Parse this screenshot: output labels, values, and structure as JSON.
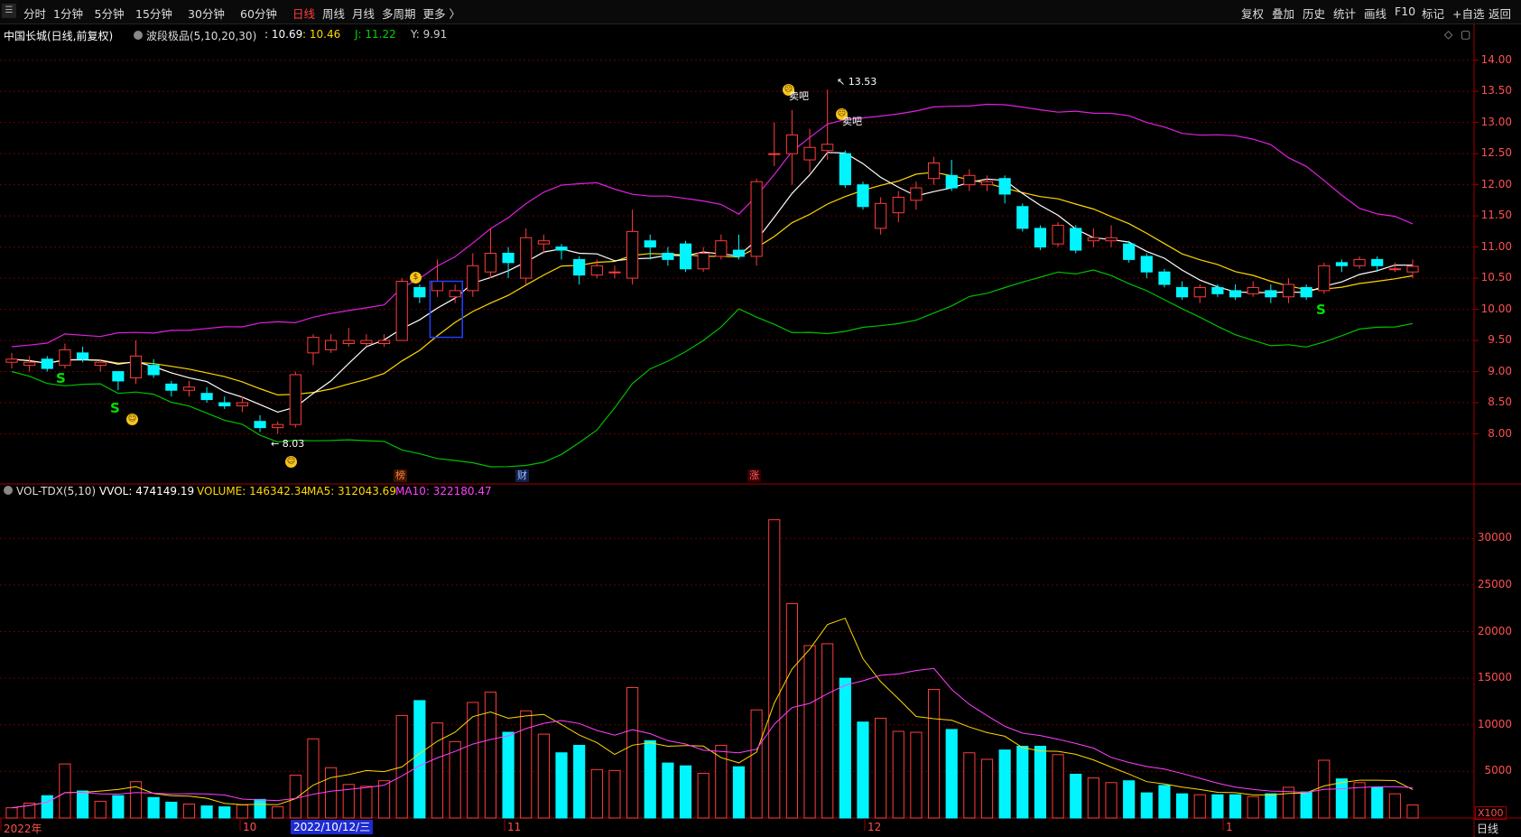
{
  "toolbar": {
    "periods": [
      "分时",
      "1分钟",
      "5分钟",
      "15分钟",
      "30分钟",
      "60分钟",
      "日线",
      "周线",
      "月线",
      "多周期",
      "更多 〉"
    ],
    "active_period": "日线",
    "right_buttons": [
      "复权",
      "叠加",
      "历史",
      "统计",
      "画线",
      "F10",
      "标记",
      "+自选",
      "返回"
    ]
  },
  "main_panel": {
    "stock_title": "中国长城(日线,前复权)",
    "indicator_name": "波段极品(5,10,20,30)",
    "readout": {
      "a": ": 10.69",
      "b": ": 10.46",
      "j": "J: 11.22",
      "y": "Y: 9.91"
    },
    "price_ticks": [
      "14.00",
      "13.50",
      "13.00",
      "12.50",
      "12.00",
      "11.50",
      "11.00",
      "10.50",
      "10.00",
      "9.50",
      "9.00",
      "8.50",
      "8.00"
    ],
    "high_label": "13.53",
    "low_label": "8.03",
    "annotations": [
      "卖吧",
      "卖吧"
    ],
    "signals": [
      "S",
      "S",
      "S"
    ],
    "events": [
      "榜",
      "财",
      "涨"
    ]
  },
  "volume_panel": {
    "indicator": "VOL-TDX(5,10)",
    "vvol": "VVOL: 474149.19",
    "volume": "VOLUME: 146342.34",
    "ma5": "MA5: 312043.69",
    "ma10": "MA10: 322180.47",
    "ticks": [
      "30000",
      "25000",
      "20000",
      "15000",
      "10000",
      "5000"
    ],
    "unit": "X100"
  },
  "xaxis": {
    "labels": [
      "2022年",
      "10",
      "11",
      "12",
      "1"
    ],
    "cursor_date": "2022/10/12/三",
    "period": "日线"
  },
  "colors": {
    "up": "#ff3c3c",
    "down": "#00f5ff",
    "ma_white": "#ffffff",
    "ma_yellow": "#ffd700",
    "band_magenta": "#e020e0",
    "band_green": "#00c000",
    "axis": "#a00000"
  },
  "chart_data": {
    "type": "candlestick",
    "price_ylim": [
      7.5,
      14.3
    ],
    "volume_ylim": [
      0,
      34000
    ],
    "candles": [
      {
        "o": 9.15,
        "c": 9.2,
        "h": 9.3,
        "l": 9.05,
        "v": 1100
      },
      {
        "o": 9.1,
        "c": 9.15,
        "h": 9.25,
        "l": 9.0,
        "v": 1600
      },
      {
        "o": 9.2,
        "c": 9.05,
        "h": 9.25,
        "l": 9.0,
        "v": 2400
      },
      {
        "o": 9.1,
        "c": 9.35,
        "h": 9.45,
        "l": 9.05,
        "v": 5800
      },
      {
        "o": 9.3,
        "c": 9.2,
        "h": 9.4,
        "l": 9.15,
        "v": 2900
      },
      {
        "o": 9.1,
        "c": 9.15,
        "h": 9.2,
        "l": 9.0,
        "v": 1800
      },
      {
        "o": 9.0,
        "c": 8.85,
        "h": 9.0,
        "l": 8.7,
        "v": 2400
      },
      {
        "o": 8.9,
        "c": 9.25,
        "h": 9.5,
        "l": 8.8,
        "v": 3900
      },
      {
        "o": 9.1,
        "c": 8.95,
        "h": 9.2,
        "l": 8.9,
        "v": 2200
      },
      {
        "o": 8.8,
        "c": 8.7,
        "h": 8.85,
        "l": 8.6,
        "v": 1700
      },
      {
        "o": 8.7,
        "c": 8.75,
        "h": 8.85,
        "l": 8.6,
        "v": 1500
      },
      {
        "o": 8.65,
        "c": 8.55,
        "h": 8.75,
        "l": 8.5,
        "v": 1300
      },
      {
        "o": 8.5,
        "c": 8.45,
        "h": 8.6,
        "l": 8.4,
        "v": 1200
      },
      {
        "o": 8.45,
        "c": 8.5,
        "h": 8.6,
        "l": 8.35,
        "v": 1400
      },
      {
        "o": 8.2,
        "c": 8.1,
        "h": 8.3,
        "l": 8.03,
        "v": 2000
      },
      {
        "o": 8.1,
        "c": 8.15,
        "h": 8.2,
        "l": 8.0,
        "v": 1200
      },
      {
        "o": 8.15,
        "c": 8.95,
        "h": 9.0,
        "l": 8.1,
        "v": 4600
      },
      {
        "o": 9.3,
        "c": 9.55,
        "h": 9.6,
        "l": 9.1,
        "v": 8500
      },
      {
        "o": 9.35,
        "c": 9.5,
        "h": 9.6,
        "l": 9.3,
        "v": 5400
      },
      {
        "o": 9.45,
        "c": 9.5,
        "h": 9.7,
        "l": 9.4,
        "v": 3600
      },
      {
        "o": 9.45,
        "c": 9.5,
        "h": 9.6,
        "l": 9.4,
        "v": 3400
      },
      {
        "o": 9.45,
        "c": 9.5,
        "h": 9.6,
        "l": 9.4,
        "v": 4000
      },
      {
        "o": 9.5,
        "c": 10.45,
        "h": 10.5,
        "l": 9.5,
        "v": 11000
      },
      {
        "o": 10.35,
        "c": 10.2,
        "h": 10.4,
        "l": 10.1,
        "v": 12600
      },
      {
        "o": 10.3,
        "c": 10.45,
        "h": 10.8,
        "l": 10.2,
        "v": 10200
      },
      {
        "o": 10.2,
        "c": 10.3,
        "h": 10.4,
        "l": 10.1,
        "v": 8200
      },
      {
        "o": 10.3,
        "c": 10.7,
        "h": 10.9,
        "l": 10.2,
        "v": 12400
      },
      {
        "o": 10.6,
        "c": 10.9,
        "h": 11.3,
        "l": 10.5,
        "v": 13500
      },
      {
        "o": 10.9,
        "c": 10.75,
        "h": 11.0,
        "l": 10.5,
        "v": 9200
      },
      {
        "o": 10.5,
        "c": 11.15,
        "h": 11.3,
        "l": 10.4,
        "v": 11500
      },
      {
        "o": 11.05,
        "c": 11.1,
        "h": 11.2,
        "l": 10.9,
        "v": 9000
      },
      {
        "o": 11.0,
        "c": 10.95,
        "h": 11.05,
        "l": 10.8,
        "v": 7000
      },
      {
        "o": 10.8,
        "c": 10.55,
        "h": 10.85,
        "l": 10.4,
        "v": 7800
      },
      {
        "o": 10.55,
        "c": 10.7,
        "h": 10.8,
        "l": 10.5,
        "v": 5200
      },
      {
        "o": 10.6,
        "c": 10.6,
        "h": 10.7,
        "l": 10.5,
        "v": 5100
      },
      {
        "o": 10.5,
        "c": 11.25,
        "h": 11.6,
        "l": 10.4,
        "v": 14000
      },
      {
        "o": 11.1,
        "c": 11.0,
        "h": 11.2,
        "l": 10.8,
        "v": 8300
      },
      {
        "o": 10.9,
        "c": 10.8,
        "h": 11.0,
        "l": 10.7,
        "v": 5900
      },
      {
        "o": 11.05,
        "c": 10.65,
        "h": 11.1,
        "l": 10.6,
        "v": 5600
      },
      {
        "o": 10.65,
        "c": 10.9,
        "h": 11.0,
        "l": 10.6,
        "v": 4800
      },
      {
        "o": 10.85,
        "c": 11.1,
        "h": 11.2,
        "l": 10.8,
        "v": 7800
      },
      {
        "o": 10.95,
        "c": 10.85,
        "h": 11.2,
        "l": 10.8,
        "v": 5500
      },
      {
        "o": 10.85,
        "c": 12.05,
        "h": 12.1,
        "l": 10.7,
        "v": 11600
      },
      {
        "o": 12.5,
        "c": 12.5,
        "h": 13.0,
        "l": 12.3,
        "v": 32000
      },
      {
        "o": 12.5,
        "c": 12.8,
        "h": 13.2,
        "l": 12.0,
        "v": 23000
      },
      {
        "o": 12.4,
        "c": 12.6,
        "h": 12.9,
        "l": 12.2,
        "v": 18500
      },
      {
        "o": 12.55,
        "c": 12.65,
        "h": 13.53,
        "l": 12.4,
        "v": 18700
      },
      {
        "o": 12.5,
        "c": 12.0,
        "h": 12.55,
        "l": 11.95,
        "v": 15000
      },
      {
        "o": 12.0,
        "c": 11.65,
        "h": 12.05,
        "l": 11.6,
        "v": 10300
      },
      {
        "o": 11.3,
        "c": 11.7,
        "h": 11.8,
        "l": 11.2,
        "v": 10700
      },
      {
        "o": 11.55,
        "c": 11.8,
        "h": 11.9,
        "l": 11.4,
        "v": 9300
      },
      {
        "o": 11.75,
        "c": 11.95,
        "h": 12.05,
        "l": 11.6,
        "v": 9200
      },
      {
        "o": 12.1,
        "c": 12.35,
        "h": 12.45,
        "l": 12.0,
        "v": 13800
      },
      {
        "o": 12.15,
        "c": 11.95,
        "h": 12.4,
        "l": 11.9,
        "v": 9500
      },
      {
        "o": 12.0,
        "c": 12.15,
        "h": 12.25,
        "l": 11.9,
        "v": 7000
      },
      {
        "o": 12.0,
        "c": 12.05,
        "h": 12.15,
        "l": 11.9,
        "v": 6300
      },
      {
        "o": 12.1,
        "c": 11.85,
        "h": 12.15,
        "l": 11.7,
        "v": 7300
      },
      {
        "o": 11.65,
        "c": 11.3,
        "h": 11.7,
        "l": 11.25,
        "v": 7700
      },
      {
        "o": 11.3,
        "c": 11.0,
        "h": 11.35,
        "l": 10.95,
        "v": 7700
      },
      {
        "o": 11.05,
        "c": 11.35,
        "h": 11.4,
        "l": 11.0,
        "v": 6800
      },
      {
        "o": 11.3,
        "c": 10.95,
        "h": 11.35,
        "l": 10.9,
        "v": 4700
      },
      {
        "o": 11.1,
        "c": 11.15,
        "h": 11.3,
        "l": 11.0,
        "v": 4300
      },
      {
        "o": 11.1,
        "c": 11.15,
        "h": 11.35,
        "l": 11.0,
        "v": 3800
      },
      {
        "o": 11.05,
        "c": 10.8,
        "h": 11.1,
        "l": 10.75,
        "v": 4000
      },
      {
        "o": 10.85,
        "c": 10.6,
        "h": 10.9,
        "l": 10.5,
        "v": 2700
      },
      {
        "o": 10.6,
        "c": 10.4,
        "h": 10.65,
        "l": 10.35,
        "v": 3500
      },
      {
        "o": 10.35,
        "c": 10.2,
        "h": 10.45,
        "l": 10.15,
        "v": 2600
      },
      {
        "o": 10.2,
        "c": 10.35,
        "h": 10.4,
        "l": 10.1,
        "v": 2500
      },
      {
        "o": 10.35,
        "c": 10.25,
        "h": 10.4,
        "l": 10.2,
        "v": 2500
      },
      {
        "o": 10.3,
        "c": 10.2,
        "h": 10.4,
        "l": 10.15,
        "v": 2500
      },
      {
        "o": 10.25,
        "c": 10.35,
        "h": 10.45,
        "l": 10.2,
        "v": 2300
      },
      {
        "o": 10.3,
        "c": 10.2,
        "h": 10.4,
        "l": 10.1,
        "v": 2600
      },
      {
        "o": 10.2,
        "c": 10.4,
        "h": 10.5,
        "l": 10.1,
        "v": 3300
      },
      {
        "o": 10.35,
        "c": 10.2,
        "h": 10.4,
        "l": 10.15,
        "v": 2800
      },
      {
        "o": 10.3,
        "c": 10.7,
        "h": 10.75,
        "l": 10.25,
        "v": 6200
      },
      {
        "o": 10.75,
        "c": 10.7,
        "h": 10.8,
        "l": 10.6,
        "v": 4200
      },
      {
        "o": 10.7,
        "c": 10.8,
        "h": 10.85,
        "l": 10.65,
        "v": 3800
      },
      {
        "o": 10.8,
        "c": 10.7,
        "h": 10.85,
        "l": 10.6,
        "v": 3300
      },
      {
        "o": 10.65,
        "c": 10.65,
        "h": 10.75,
        "l": 10.6,
        "v": 2600
      },
      {
        "o": 10.6,
        "c": 10.69,
        "h": 10.8,
        "l": 10.5,
        "v": 1400
      }
    ]
  }
}
